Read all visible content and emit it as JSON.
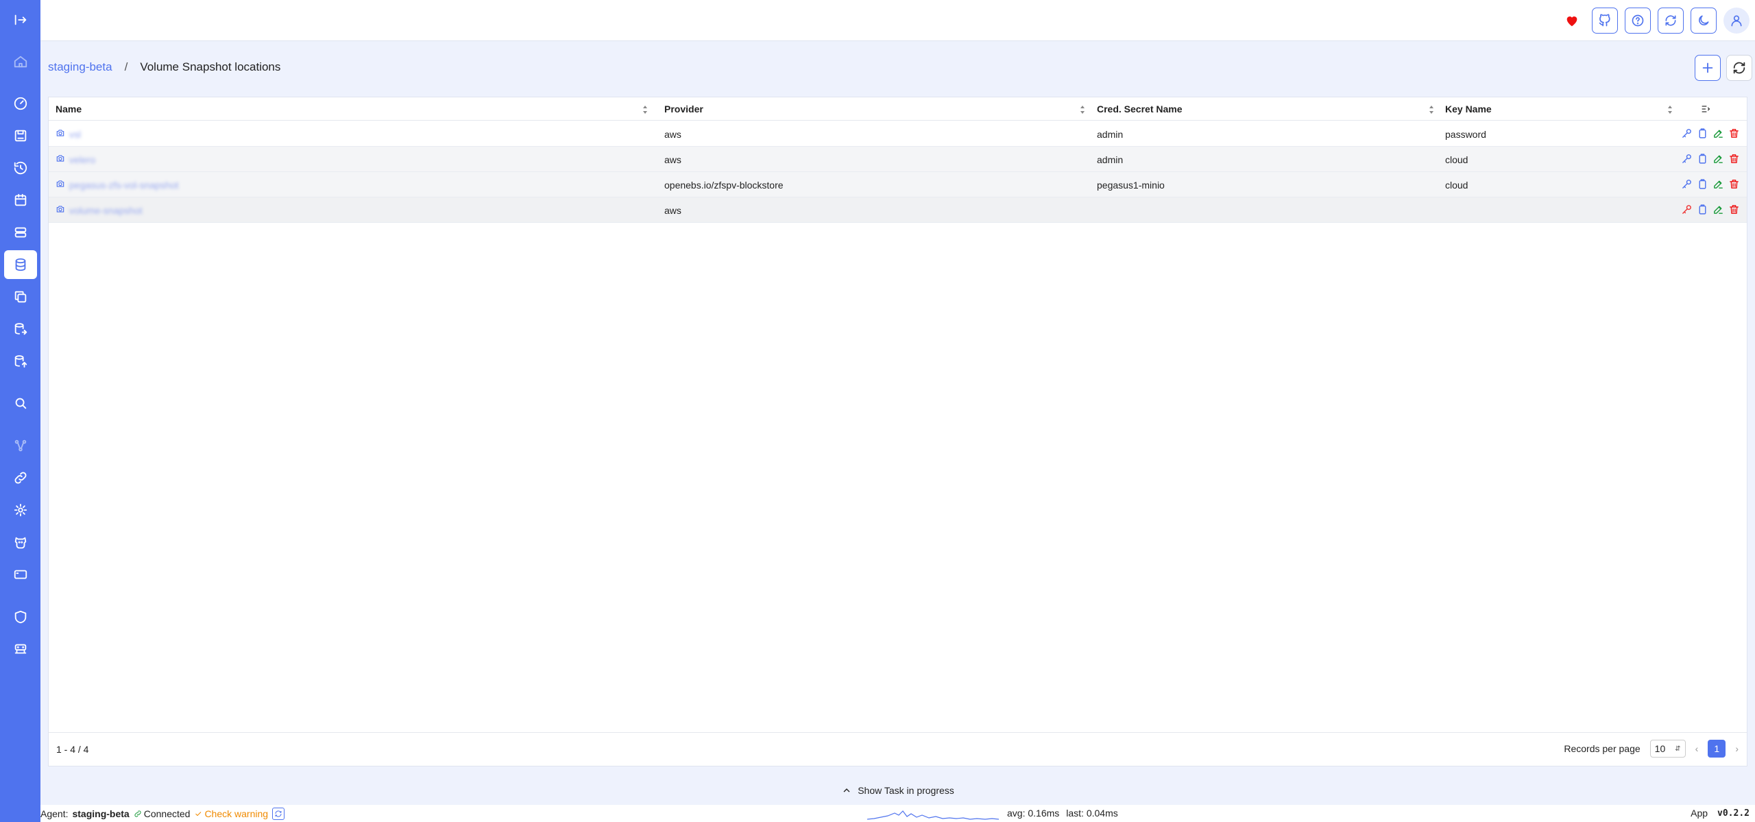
{
  "header": {
    "icons": [
      "heart-icon",
      "github-icon",
      "help-icon",
      "sync-icon",
      "moon-icon",
      "user-icon"
    ]
  },
  "breadcrumb": {
    "parent": "staging-beta",
    "separator": "/",
    "current": "Volume Snapshot locations"
  },
  "table": {
    "columns": [
      {
        "label": "Name"
      },
      {
        "label": "Provider"
      },
      {
        "label": "Cred. Secret Name"
      },
      {
        "label": "Key Name"
      }
    ],
    "rows": [
      {
        "name": "vsl",
        "provider": "aws",
        "secret": "admin",
        "key": "password",
        "key_warn": false
      },
      {
        "name": "velero",
        "provider": "aws",
        "secret": "admin",
        "key": "cloud",
        "key_warn": false
      },
      {
        "name": "pegasus-zfs-vol-snapshot",
        "provider": "openebs.io/zfspv-blockstore",
        "secret": "pegasus1-minio",
        "key": "cloud",
        "key_warn": false
      },
      {
        "name": "volume-snapshot",
        "provider": "aws",
        "secret": "",
        "key": "",
        "key_warn": true
      }
    ]
  },
  "footer": {
    "count": "1 - 4 / 4",
    "records_label": "Records per page",
    "per_page": "10",
    "current_page": "1"
  },
  "taskbar": {
    "label": "Show Task in progress"
  },
  "status": {
    "agent_label": "Agent:",
    "agent_name": "staging-beta",
    "connected": "Connected",
    "warning": "Check warning",
    "avg": "avg: 0.16ms",
    "last": "last: 0.04ms",
    "app": "App",
    "version": "v0.2.2"
  },
  "colors": {
    "accent": "#4f73ee",
    "sidebar": "#4f73ee",
    "edit": "#1a9a3a",
    "delete": "#e11111",
    "warning": "#f08a00"
  }
}
